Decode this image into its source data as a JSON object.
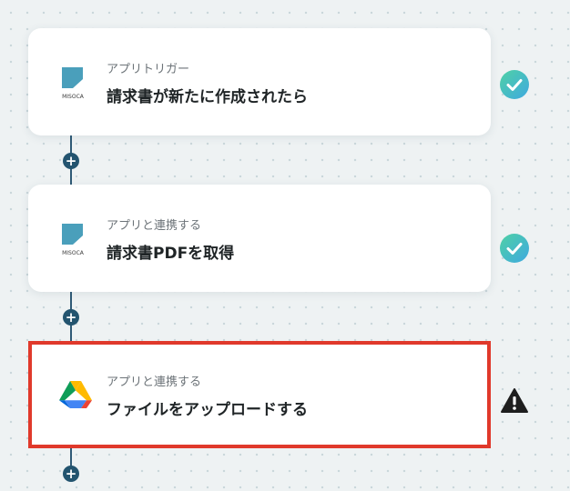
{
  "steps": [
    {
      "subtitle": "アプリトリガー",
      "title": "請求書が新たに作成されたら",
      "app_icon": "misoca-logo",
      "logo_text": "MISOCA",
      "status": "check-icon"
    },
    {
      "subtitle": "アプリと連携する",
      "title": "請求書PDFを取得",
      "app_icon": "misoca-logo",
      "logo_text": "MISOCA",
      "status": "check-icon"
    },
    {
      "subtitle": "アプリと連携する",
      "title": "ファイルをアップロードする",
      "app_icon": "google-drive-logo",
      "status": "warning-icon"
    }
  ],
  "add_step_label": "+",
  "colors": {
    "connector": "#2f5a76",
    "add_button": "#23546f",
    "check_start": "#4fd1a5",
    "check_end": "#3fa9e0",
    "selected_border": "#e0392b",
    "warning": "#1e1e1e"
  }
}
